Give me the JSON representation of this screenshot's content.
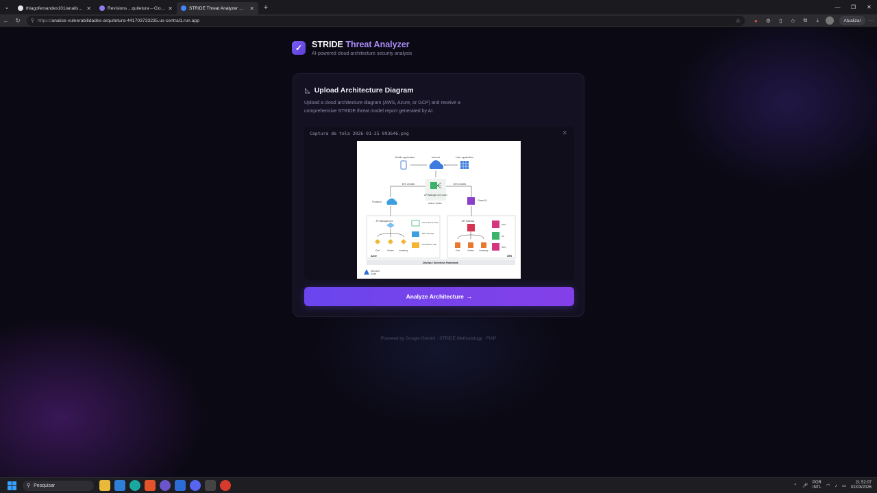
{
  "browser": {
    "tabs": [
      {
        "title": "thiagofernandes101/analise-vulne",
        "favicon_color": "#e6e6e6",
        "active": false
      },
      {
        "title": "Revisions ...quitetura – Cloud Run",
        "favicon_color": "#8e7cf0",
        "active": false
      },
      {
        "title": "STRIDE Threat Analyzer — Cloud A",
        "favicon_color": "#4285f4",
        "active": true
      }
    ],
    "url_prefix": "https://",
    "url_host": "analise-vulnerabilidades-arquitetura-441703733235.us-central1.run.app",
    "update_label": "Atualizar"
  },
  "app": {
    "title_main": "STRIDE",
    "title_accent": "Threat Analyzer",
    "subtitle": "AI-powered cloud architecture security analysis",
    "accent_color": "#a98cf7"
  },
  "upload": {
    "title": "Upload Architecture Diagram",
    "description": "Upload a cloud architecture diagram (AWS, Azure, or GCP) and receive a comprehensive STRIDE threat model report generated by AI.",
    "file_name": "Captura de tela 2026-01-25 093646.png"
  },
  "diagram": {
    "mobile_label": "Mobile application",
    "internet_label": "Internet",
    "user_label": "User application",
    "traffic_left": "50% of traffic",
    "traffic_right": "50% of traffic",
    "api_manager_label": "API Manager and router",
    "active_label": "Active / Active",
    "frontdoor_label": "Frontdoor",
    "route53_label": "Route 53",
    "azure_apim_label": "API Management",
    "aws_apigw_label": "API Gateway",
    "event_hubs_label": "Azure Event Hubs",
    "blob_label": "Blob Storage",
    "notification_label": "Notification Hub",
    "sqs_label": "SQS",
    "s3_label": "S3",
    "sns_label": "SNS",
    "cart_label": "Cart",
    "orders_label": "Orders",
    "inventory_label": "Inventory",
    "azure_label": "Azure",
    "aws_label": "AWS",
    "framework_label": "DevOps / Serverless Framework",
    "ms_label": "Microsoft",
    "ms_sub": "Azure"
  },
  "actions": {
    "analyze_label": "Analyze Architecture",
    "analyze_arrow": "→"
  },
  "footer": {
    "text": "Powered by Google Gemini · STRIDE Methodology · FIAP"
  },
  "taskbar": {
    "search_label": "Pesquisar",
    "lang_top": "POR",
    "lang_bottom": "INTL",
    "time": "21:52:07",
    "date": "02/03/2026"
  }
}
